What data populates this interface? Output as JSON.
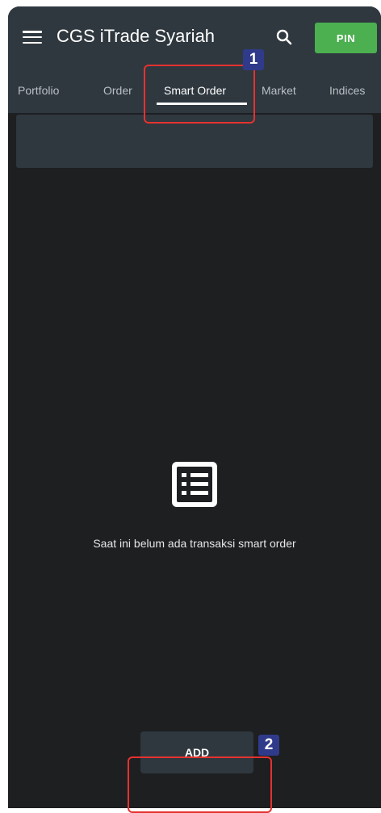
{
  "app": {
    "title": "CGS iTrade Syariah"
  },
  "toolbar": {
    "pin_label": "PIN",
    "search_icon": "search-icon",
    "menu_icon": "menu-icon"
  },
  "tabs": [
    {
      "label": "Portfolio",
      "active": false
    },
    {
      "label": "Order",
      "active": false
    },
    {
      "label": "Smart Order",
      "active": true
    },
    {
      "label": "Market",
      "active": false
    },
    {
      "label": "Indices",
      "active": false
    }
  ],
  "empty_state": {
    "icon": "list-icon",
    "message": "Saat ini belum ada transaksi smart order"
  },
  "actions": {
    "add_label": "ADD"
  },
  "callouts": [
    {
      "number": "1"
    },
    {
      "number": "2"
    }
  ],
  "colors": {
    "appbar": "#2f383f",
    "background": "#1e1f21",
    "pin_green": "#4caf50",
    "highlight_red": "#e5322f",
    "badge_blue": "#2f3b8a"
  }
}
